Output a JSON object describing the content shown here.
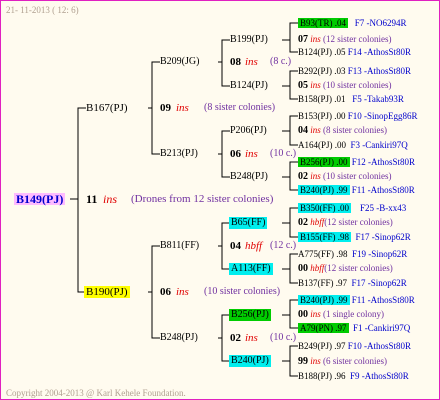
{
  "header_date": "21- 11-2013 ( 12: 6)",
  "copyright": "Copyright 2004-2013 @ Karl Kehele Foundation.",
  "root": {
    "name": "B149(PJ)",
    "num": "11",
    "ins": "ins",
    "note": "(Drones from 12 sister colonies)"
  },
  "g1_top": {
    "name": "B167(PJ)",
    "num": "09",
    "ins": "ins",
    "note": "(8 sister colonies)"
  },
  "g1_bot": {
    "name": "B190(PJ)",
    "num": "06",
    "ins": "ins",
    "note": "(10 sister colonies)"
  },
  "g2": {
    "b209": {
      "name": "B209(JG)",
      "num": "08",
      "ins": "ins",
      "note": "(8 c.)"
    },
    "b213": {
      "name": "B213(PJ)",
      "num": "06",
      "ins": "ins",
      "note": "(10 c.)"
    },
    "b811": {
      "name": "B811(FF)",
      "num": "04",
      "ins": "hbff",
      "note": "(12 c.)"
    },
    "b248": {
      "name": "B248(PJ)",
      "num": "02",
      "ins": "ins",
      "note": "(10 c.)"
    }
  },
  "g3": {
    "b199": "B199(PJ)",
    "b124": "B124(PJ)",
    "p206": "P206(PJ)",
    "b248a": "B248(PJ)",
    "b65": "B65(FF)",
    "a113": "A113(FF)",
    "b256": "B256(PJ)",
    "b240": "B240(PJ)"
  },
  "g4": [
    {
      "name": "B93(TR) .04",
      "ref": "F7 -NO6294R"
    },
    {
      "num": "07",
      "ins": "ins",
      "note": "(12 sister colonies)"
    },
    {
      "name": "B124(PJ) .05",
      "ref": "F14 -AthosSt80R"
    },
    {
      "name": "B292(PJ) .03",
      "ref": "F13 -AthosSt80R"
    },
    {
      "num": "05",
      "ins": "ins",
      "note": "(10 sister colonies)"
    },
    {
      "name": "B158(PJ) .01",
      "ref": "F5 -Takab93R"
    },
    {
      "name": "B153(PJ) .00",
      "ref": "F10 -SinopEgg86R"
    },
    {
      "num": "04",
      "ins": "ins",
      "note": "(8 sister colonies)"
    },
    {
      "name": "A164(PJ) .00",
      "ref": "F3 -Cankiri97Q"
    },
    {
      "name": "B256(PJ) .00",
      "ref": "F12 -AthosSt80R"
    },
    {
      "num": "02",
      "ins": "ins",
      "note": "(10 sister colonies)"
    },
    {
      "name": "B240(PJ) .99",
      "ref": "F11 -AthosSt80R"
    },
    {
      "name": "B350(FF) .00",
      "ref": "F25 -B-xx43"
    },
    {
      "num": "02",
      "ins": "hbff",
      "note": "(12 sister colonies)"
    },
    {
      "name": "B155(FF) .98",
      "ref": "F17 -Sinop62R"
    },
    {
      "name": "A775(FF) .98",
      "ref": "F19 -Sinop62R"
    },
    {
      "num": "00",
      "ins": "hbff",
      "note": "(12 sister colonies)"
    },
    {
      "name": "B137(FF) .97",
      "ref": "F17 -Sinop62R"
    },
    {
      "name": "B240(PJ) .99",
      "ref": "F11 -AthosSt80R"
    },
    {
      "num": "00",
      "ins": "ins",
      "note": "(1 single colony)"
    },
    {
      "name": "A79(PN) .97",
      "ref": "F1 -Cankiri97Q"
    },
    {
      "name": "B249(PJ) .97",
      "ref": "F10 -AthosSt80R"
    },
    {
      "num": "99",
      "ins": "ins",
      "note": "(6 sister colonies)"
    },
    {
      "name": "B188(PJ) .96",
      "ref": "F9 -AthosSt80R"
    }
  ],
  "colors": {
    "green": "#00cc00",
    "cyan": "#00eeee",
    "yellow": "#ffff00",
    "pink": "#ffbbff",
    "frame": "#e020c0"
  }
}
